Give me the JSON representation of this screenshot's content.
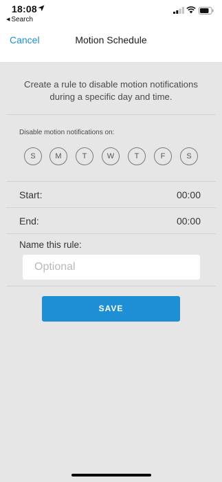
{
  "status_bar": {
    "time": "18:08",
    "back_label": "Search",
    "icons": [
      "location-arrow-icon",
      "signal-icon",
      "wifi-icon",
      "battery-icon"
    ]
  },
  "nav": {
    "cancel_label": "Cancel",
    "title": "Motion Schedule"
  },
  "intro_text": "Create a rule to disable motion notifications during a specific day and time.",
  "days": {
    "label": "Disable motion notifications on:",
    "items": [
      "S",
      "M",
      "T",
      "W",
      "T",
      "F",
      "S"
    ]
  },
  "start": {
    "label": "Start:",
    "value": "00:00"
  },
  "end": {
    "label": "End:",
    "value": "00:00"
  },
  "name_rule": {
    "label": "Name this rule:",
    "placeholder": "Optional",
    "value": ""
  },
  "save_label": "SAVE",
  "colors": {
    "accent": "#1e8fd5",
    "background": "#e6e6e6"
  }
}
